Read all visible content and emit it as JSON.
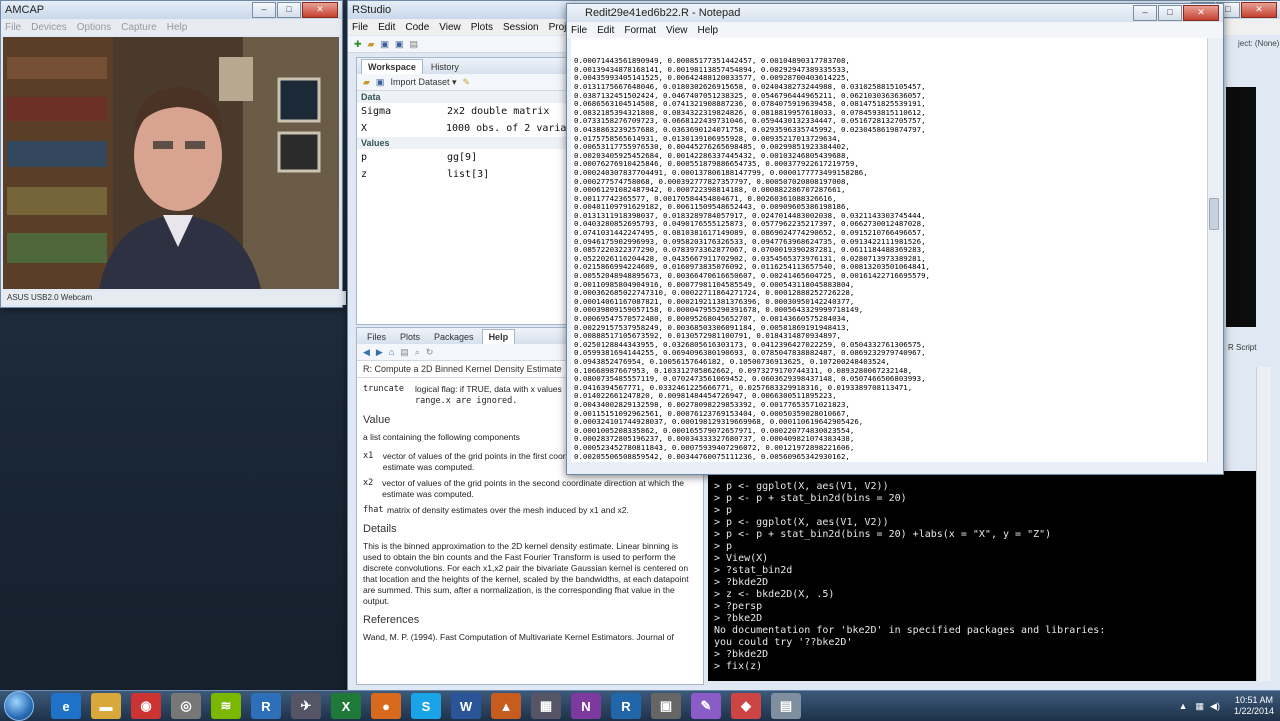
{
  "amcap": {
    "title": "AMCAP",
    "menu": [
      "File",
      "Devices",
      "Options",
      "Capture",
      "Help"
    ],
    "status": "ASUS USB2.0 Webcam"
  },
  "rstudio": {
    "title": "RStudio",
    "menu": [
      "File",
      "Edit",
      "Code",
      "View",
      "Plots",
      "Session",
      "Project",
      "B"
    ],
    "workspace": {
      "tabs": [
        "Workspace",
        "History"
      ],
      "import_label": "Import Dataset",
      "data_header": "Data",
      "values_header": "Values",
      "rows": [
        {
          "name": "Sigma",
          "value": "2x2 double matrix"
        },
        {
          "name": "X",
          "value": "1000 obs. of 2 variab"
        }
      ],
      "value_rows": [
        {
          "name": "p",
          "value": "gg[9]"
        },
        {
          "name": "z",
          "value": "list[3]"
        }
      ]
    },
    "help": {
      "tabs": [
        "Files",
        "Plots",
        "Packages",
        "Help"
      ],
      "topic": "R: Compute a 2D Binned Kernel Density Estimate",
      "truncate_label": "truncate",
      "truncate_desc": "logical flag: if TRUE, data with x values",
      "truncate_desc2": "range.x are ignored.",
      "value_heading": "Value",
      "value_intro": "a list containing the following components",
      "x1_name": "x1",
      "x1_desc": "vector of values of the grid points in the first coordinate direction at which the estimate was computed.",
      "x2_name": "x2",
      "x2_desc": "vector of values of the grid points in the second coordinate direction at which the estimate was computed.",
      "fhat_name": "fhat",
      "fhat_desc": "matrix of density estimates over the mesh induced by x1 and x2.",
      "details_heading": "Details",
      "details_text": "This is the binned approximation to the 2D kernel density estimate. Linear binning is used to obtain the bin counts and the Fast Fourier Transform is used to perform the discrete convolutions. For each x1,x2 pair the bivariate Gaussian kernel is centered on that location and the heights of the kernel, scaled by the bandwidths, at each datapoint are summed. This sum, after a normalization, is the corresponding fhat value in the output.",
      "references_heading": "References",
      "references_text": "Wand, M. P. (1994). Fast Computation of Multivariate Kernel Estimators. Journal of"
    },
    "console_lines": [
      "> p <- ggplot(X, aes(V1, V2))",
      "> p <- p + stat_bin2d(bins = 20)",
      "> p",
      "> p <- ggplot(X, aes(V1, V2))",
      "> p <- p + stat_bin2d(bins = 20) +labs(x = \"X\", y = \"Z\")",
      "> p",
      "> View(X)",
      "> ?stat_bin2d",
      "> ?bkde2D",
      "> z <- bkde2D(X, .5)",
      "> ?persp",
      "> ?bke2D",
      "No documentation for 'bke2D' in specified packages and libraries:",
      "you could try '??bke2D'",
      "> ?bkde2D",
      "> fix(z)"
    ],
    "right_labels": {
      "project": "ject: (None)",
      "rscript": "R Script"
    }
  },
  "notepad": {
    "title": "Redit29e41ed6b22.R - Notepad",
    "menu": [
      "File",
      "Edit",
      "Format",
      "View",
      "Help"
    ],
    "lines": [
      "0.00071443561890949, 0.00085177351442457, 0.00104890317783708,",
      "0.00139434878168141, 0.00198113857454894, 0.00292947389335533,",
      "0.00435993405141525, 0.00642488120033577, 0.00928700403614225,",
      "0.0131175667648046, 0.0180302626915658, 0.0240438273244988, 0.0310258815105457,",
      "0.0387132451502424, 0.0467407051238325, 0.0546796444965211, 0.0621030363636057,",
      "0.0686563104514508, 0.0741321908887236, 0.0784075919639458, 0.0814751825539191,",
      "0.0832185394321808, 0.0834322319824826, 0.0818819957618033, 0.0784593815110612,",
      "0.0733158276709723, 0.0668122439731046, 0.0594430132334447, 0.0516728132705757,",
      "0.0438863239257688, 0.0363690124071758, 0.0293596335745992, 0.0230458619874797,",
      "0.0175758565614931, 0.0130139106955928, 0.00935217013729634,",
      "0.00653117755976530, 0.00445276265698485, 0.00299851923384402,",
      "0.00203405925452684, 0.00142286337445432, 0.00103246805439688,",
      "0.00076276910425846, 0.000551879886654735, 0.000377922617219759,",
      "0.000240307837704491, 0.000137806188147799, 0.0000177773499158286,",
      "0.000277574758068, 0.000392777827357797, 0.000507020808197008,",
      "0.00061291082487942, 0.000722398814188, 0.000882286707287661,",
      "0.00117742365577, 0.00170584454804671, 0.00260361088326616,",
      "0.00401109791629182, 0.00611509548652443, 0.00909605386198186,",
      "0.0131311918398037, 0.0183289784057917, 0.0247014483002038, 0.0321143303745444,",
      "0.0403280852695793, 0.0490176555125873, 0.0577962235217397, 0.0662730012487028,",
      "0.0741031442247495, 0.0810381617149089, 0.0869024774290652, 0.0915210766496657,",
      "0.0946175902996993, 0.0958203176326533, 0.0947763968624735, 0.0913422111981526,",
      "0.0857220322377290, 0.0783973362877067, 0.0700019390287281, 0.0611184488369283,",
      "0.0522026116204428, 0.0435667911702902, 0.0354565373976131, 0.0280713973389281,",
      "0.0215866994224609, 0.0160973835076092, 0.0116254113657540, 0.00813203501064841,",
      "0.00552048948895673, 0.00366470616650607, 0.00241465604725, 0.00161422716695579,",
      "0.00110985804904916, 0.00077981104585549, 0.000543118045883804,",
      "0.000362685022747310, 0.00022711864271724, 0.00012888252726228,",
      "0.00014061167087821, 0.000219211381376396, 0.00030950142240377,",
      "0.00039809159057158, 0.000047955290391678, 0.0005643329999718149,",
      "0.00069547570572480, 0.00095268045652707, 0.00143660575284034,",
      "0.00229157537958249, 0.00368503306091184, 0.00581869191948413,",
      "0.00888517105673592, 0.0130572981100791, 0.0184314870934897,",
      "0.0250128844343955, 0.0326805616303173, 0.0412396427022259, 0.0504332761306575,",
      "0.0599381694144255, 0.0694096380190693, 0.0785047838882487, 0.0869232979740967,",
      "0.0943852476954, 0.10056157646182, 0.10500736913625, 0.107200248403524,",
      "0.10668987667953, 0.103312705862662, 0.0973279170744311, 0.0893280067232148,",
      "0.0800735485557119, 0.0702473561069452, 0.0603629398437148, 0.0507466506803993,",
      "0.0416394567771, 0.0332461225666771, 0.0257683329918316, 0.0193389708113471,",
      "0.014022661247820, 0.00981484454726947, 0.0066300511895223,",
      "0.00434002829132598, 0.00278098229853392, 0.00177653571021823,",
      "0.00115151092962561, 0.00076123769153404, 0.00050359028010667,",
      "0.000324101744928037, 0.000198129319669968, 0.000110619642905426,",
      "0.0001005208335862, 0.000165579072657971, 0.000220774830023554,",
      "0.00028372805196237, 0.00034333327680737, 0.000409821074383438,",
      "0.000523452780811843, 0.00075939407296072, 0.00121972898221606,",
      "0.00205506508859542, 0.00344760075111236, 0.00560965342930162,",
      "0.00873308368673823, 0.012977186167946, 0.0184234656370307,",
      "0.0250758669503724, 0.0328403066847769, 0.0415859315932221, 0.0511384083652858,"
    ]
  },
  "taskbar": {
    "time": "10:51 AM",
    "date": "1/22/2014",
    "apps": [
      {
        "name": "ie",
        "glyph": "e",
        "color": "#1e73c8"
      },
      {
        "name": "explorer",
        "glyph": "▬",
        "color": "#d8a83a"
      },
      {
        "name": "chrome",
        "glyph": "◉",
        "color": "#c33"
      },
      {
        "name": "amcap",
        "glyph": "◎",
        "color": "#777"
      },
      {
        "name": "spotify",
        "glyph": "≋",
        "color": "#7ab800"
      },
      {
        "name": "rstudio-blue",
        "glyph": "R",
        "color": "#2d6fb8"
      },
      {
        "name": "ufo",
        "glyph": "✈",
        "color": "#556"
      },
      {
        "name": "excel",
        "glyph": "X",
        "color": "#1f7a3a"
      },
      {
        "name": "firefox",
        "glyph": "●",
        "color": "#d86a1e"
      },
      {
        "name": "skype",
        "glyph": "S",
        "color": "#1aa3e6"
      },
      {
        "name": "word",
        "glyph": "W",
        "color": "#2a5699"
      },
      {
        "name": "matlab",
        "glyph": "▲",
        "color": "#c65d1e"
      },
      {
        "name": "calculator",
        "glyph": "▦",
        "color": "#556"
      },
      {
        "name": "onenote",
        "glyph": "N",
        "color": "#7c3a9e"
      },
      {
        "name": "r",
        "glyph": "R",
        "color": "#2266aa"
      },
      {
        "name": "tool",
        "glyph": "▣",
        "color": "#666"
      },
      {
        "name": "paint",
        "glyph": "✎",
        "color": "#8a5cc7"
      },
      {
        "name": "browser",
        "glyph": "◆",
        "color": "#c44"
      },
      {
        "name": "notepad",
        "glyph": "▤",
        "color": "#7f8fa0"
      }
    ]
  },
  "colors": {
    "console_bg": "#000000",
    "accent": "#2a6fb8"
  }
}
